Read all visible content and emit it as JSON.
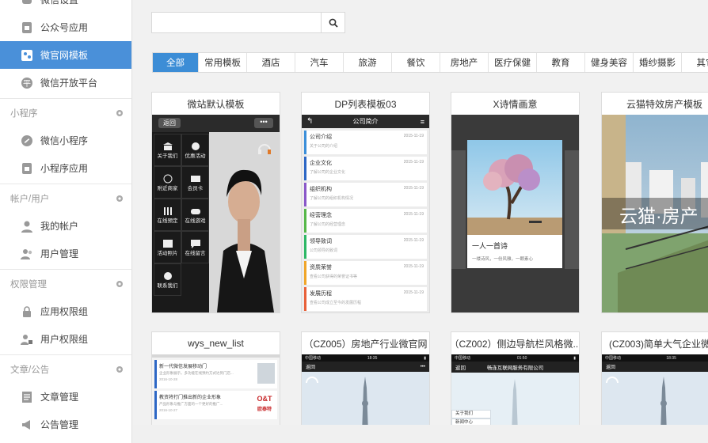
{
  "sidebar": {
    "top_items": [
      {
        "label": "微信设置"
      },
      {
        "label": "公众号应用"
      },
      {
        "label": "微官网模板"
      },
      {
        "label": "微信开放平台"
      }
    ],
    "sections": [
      {
        "title": "小程序",
        "items": [
          {
            "label": "微信小程序"
          },
          {
            "label": "小程序应用"
          }
        ]
      },
      {
        "title": "帐户/用户",
        "items": [
          {
            "label": "我的帐户"
          },
          {
            "label": "用户管理"
          }
        ]
      },
      {
        "title": "权限管理",
        "items": [
          {
            "label": "应用权限组"
          },
          {
            "label": "用户权限组"
          }
        ]
      },
      {
        "title": "文章/公告",
        "items": [
          {
            "label": "文章管理"
          },
          {
            "label": "公告管理"
          }
        ]
      }
    ]
  },
  "search": {
    "value": "",
    "placeholder": ""
  },
  "categories": [
    "全部",
    "常用模板",
    "酒店",
    "汽车",
    "旅游",
    "餐饮",
    "房地产",
    "医疗保健",
    "教育",
    "健身美容",
    "婚纱摄影",
    "其它"
  ],
  "templates": [
    {
      "title": "微站默认模板"
    },
    {
      "title": "DP列表模板03"
    },
    {
      "title": "X诗情画意"
    },
    {
      "title": "云猫特效房产模板"
    },
    {
      "title": "wys_new_list"
    },
    {
      "title": "（CZ005）房地产行业微官网"
    },
    {
      "title": "（CZ002）侧边导航栏风格微..."
    },
    {
      "title": "(CZ003)简单大气企业微站"
    }
  ],
  "previews": {
    "t1": {
      "back": "返回",
      "menu": [
        "关于我们",
        "优惠活动",
        "附近商家",
        "会员卡",
        "在线预定",
        "在线游戏",
        "活动照片",
        "在线留言",
        "联系我们"
      ]
    },
    "t2": {
      "header": "公司简介",
      "rows": [
        {
          "title": "公司介绍",
          "sub": "关于公司的介绍",
          "date": "2015-11-19"
        },
        {
          "title": "企业文化",
          "sub": "了解公司的企业文化",
          "date": "2015-11-19"
        },
        {
          "title": "组织机构",
          "sub": "了解公司的组织机构情况",
          "date": "2015-11-19"
        },
        {
          "title": "经营理念",
          "sub": "了解公司的经营理念",
          "date": "2015-11-19"
        },
        {
          "title": "领导致词",
          "sub": "公司领导的致词",
          "date": "2015-11-19"
        },
        {
          "title": "资质荣誉",
          "sub": "查看公司获得的荣誉证书等",
          "date": "2015-11-19"
        },
        {
          "title": "发展历程",
          "sub": "查看公司成立至今的发展历程",
          "date": "2015-11-19"
        }
      ]
    },
    "t3": {
      "title": "一人一首诗",
      "sub": "一缕诗风，一份风雅，一颗素心"
    },
    "t4": {
      "brand": "云猫·房产"
    },
    "t5": {
      "rows": [
        {
          "title": "新一代微信发展移动门",
          "sub": "企业形象展示，多功能在线预约方式达到门店...",
          "date": "2016-10-28"
        },
        {
          "title": "教资将打门推出新的企业形象",
          "sub": "产品形象与推广方面的一个更好的推广...",
          "date": "2016-10-27"
        }
      ]
    },
    "t6": {
      "carrier": "中国移动",
      "time": "18:35",
      "back": "返回"
    },
    "t7": {
      "carrier": "中国移动",
      "time": "01:50",
      "back": "返回",
      "company": "畅连互联网服务有限公司",
      "menu": [
        "关于我们",
        "新闻中心"
      ]
    },
    "t8": {
      "carrier": "中国移动",
      "time": "18:35",
      "back": "返回"
    }
  }
}
